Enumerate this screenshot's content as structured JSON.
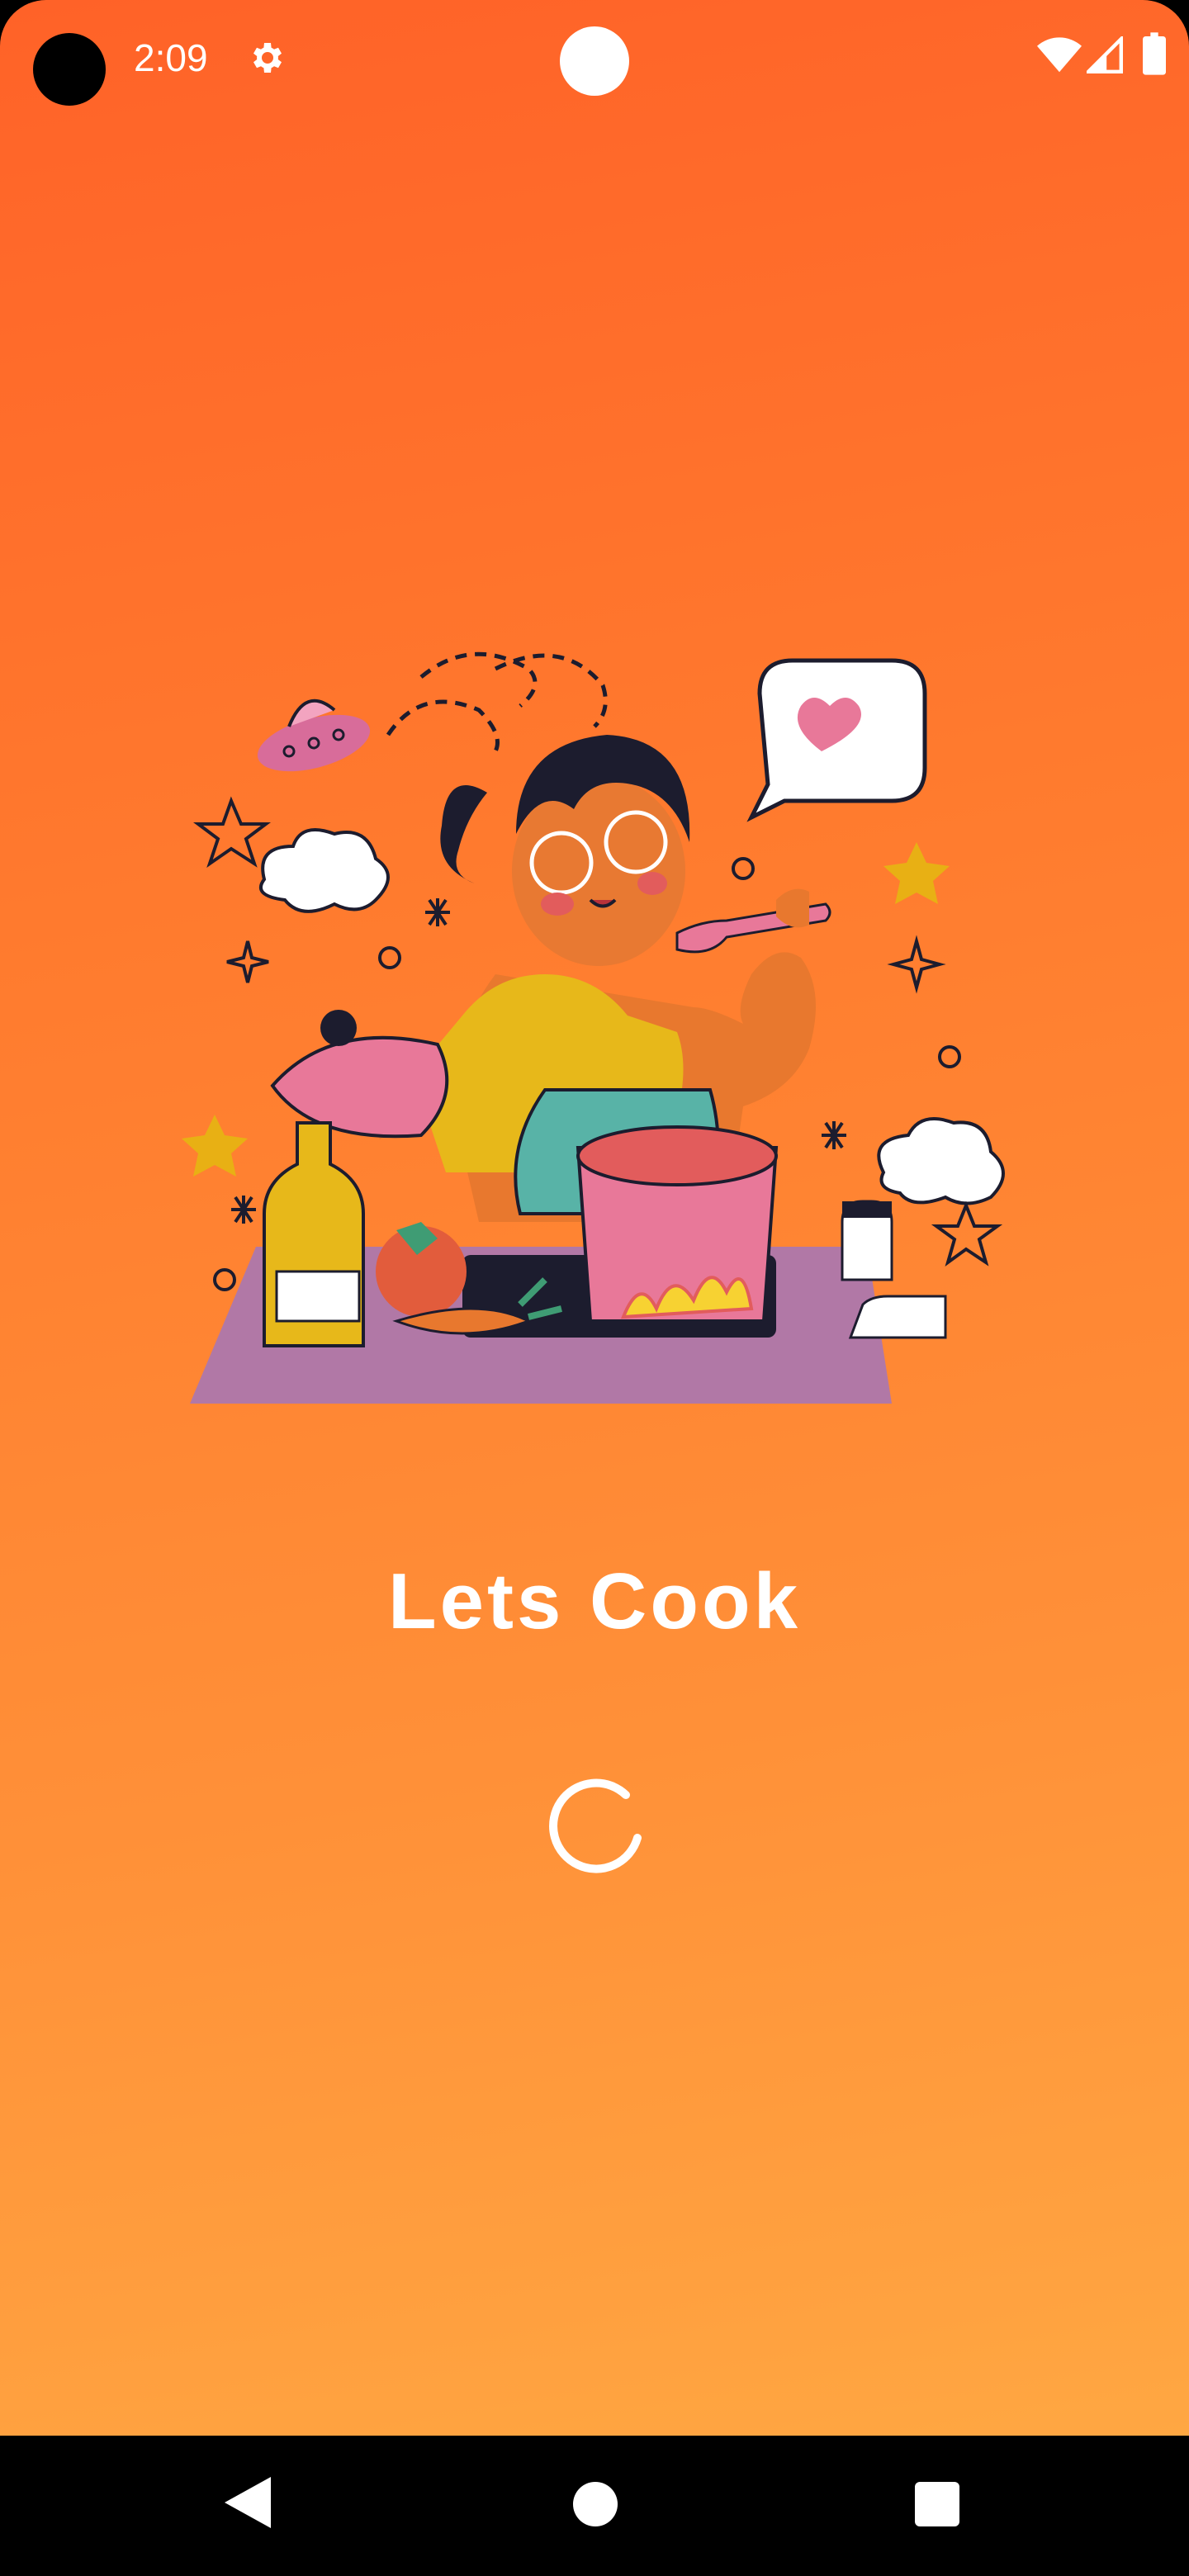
{
  "status_bar": {
    "time": "2:09",
    "icons": [
      "camera-cutout",
      "settings-icon",
      "wifi-icon",
      "signal-icon",
      "battery-icon"
    ]
  },
  "splash": {
    "title": "Lets Cook",
    "illustration": "woman-cooking-illustration",
    "loading_indicator": "circular-spinner"
  },
  "navigation_bar": {
    "buttons": [
      "back-button",
      "home-button",
      "recents-button"
    ]
  },
  "colors": {
    "gradient_top": "#ff6228",
    "gradient_bottom": "#ffa742",
    "text": "#ffffff"
  }
}
